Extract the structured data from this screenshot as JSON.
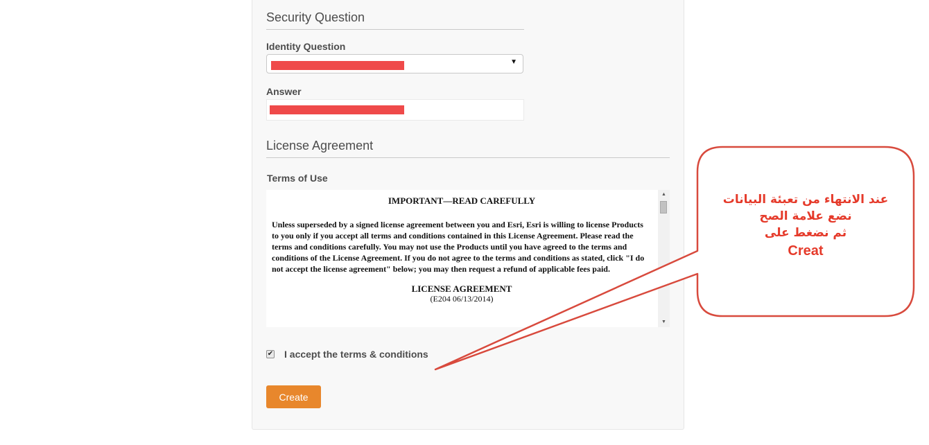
{
  "security": {
    "title": "Security Question",
    "identity_label": "Identity Question",
    "answer_label": "Answer"
  },
  "license": {
    "title": "License Agreement",
    "terms_label": "Terms of Use",
    "terms_heading": "IMPORTANT—READ CAREFULLY",
    "terms_paragraph": "Unless superseded by a signed license agreement between you and Esri, Esri is willing to license Products to you only if you accept all terms and conditions contained in this License Agreement. Please read the terms and conditions carefully. You may not use the Products until you have agreed to the terms and conditions of the License Agreement. If you do not agree to the terms and conditions as stated, click \"I do not accept the license agreement\" below; you may then request a refund of applicable fees paid.",
    "agreement_title": "LICENSE AGREEMENT",
    "agreement_code": "(E204 06/13/2014)"
  },
  "accept": {
    "label": "I accept the terms & conditions",
    "checked": true
  },
  "create_button": "Create",
  "callout": {
    "line1": "عند الانتهاء من تعبئة البيانات",
    "line2": "نضع علامة الصح",
    "line3": "ثم نضغط على",
    "line4": "Creat"
  },
  "colors": {
    "accent": "#e8872c",
    "redaction": "#ef4a4a",
    "callout": "#e53a2a"
  }
}
